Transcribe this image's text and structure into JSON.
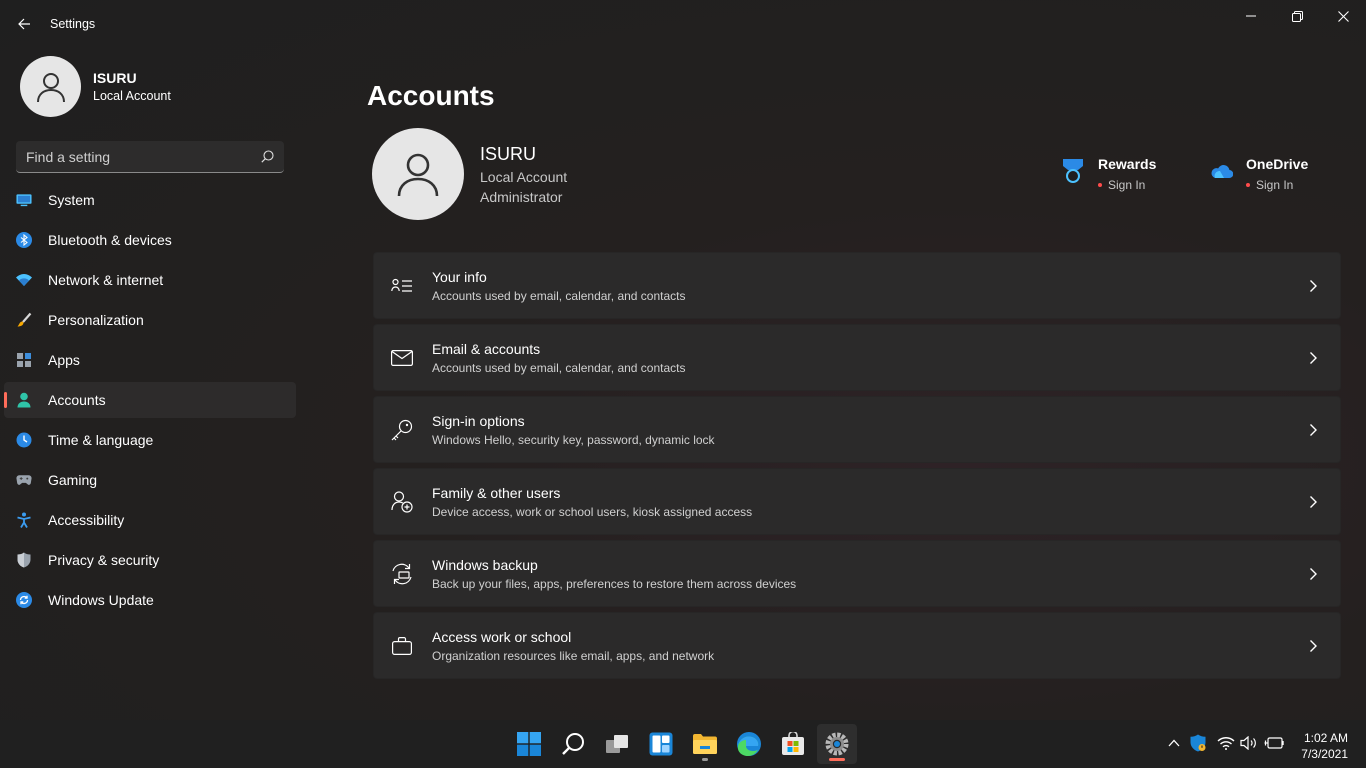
{
  "window": {
    "title": "Settings"
  },
  "sidebar": {
    "profile": {
      "name": "ISURU",
      "type": "Local Account"
    },
    "search": {
      "placeholder": "Find a setting"
    },
    "items": [
      {
        "label": "System",
        "icon": "monitor-icon",
        "selected": false
      },
      {
        "label": "Bluetooth & devices",
        "icon": "bluetooth-icon",
        "selected": false
      },
      {
        "label": "Network & internet",
        "icon": "wifi-icon",
        "selected": false
      },
      {
        "label": "Personalization",
        "icon": "paintbrush-icon",
        "selected": false
      },
      {
        "label": "Apps",
        "icon": "apps-icon",
        "selected": false
      },
      {
        "label": "Accounts",
        "icon": "person-icon",
        "selected": true
      },
      {
        "label": "Time & language",
        "icon": "clock-globe-icon",
        "selected": false
      },
      {
        "label": "Gaming",
        "icon": "gamepad-icon",
        "selected": false
      },
      {
        "label": "Accessibility",
        "icon": "accessibility-icon",
        "selected": false
      },
      {
        "label": "Privacy & security",
        "icon": "shield-icon",
        "selected": false
      },
      {
        "label": "Windows Update",
        "icon": "update-icon",
        "selected": false
      }
    ]
  },
  "main": {
    "title": "Accounts",
    "account": {
      "name": "ISURU",
      "type": "Local Account",
      "role": "Administrator"
    },
    "services": [
      {
        "title": "Rewards",
        "status": "Sign In",
        "icon": "rewards-icon"
      },
      {
        "title": "OneDrive",
        "status": "Sign In",
        "icon": "onedrive-icon"
      }
    ],
    "cards": [
      {
        "title": "Your info",
        "subtitle": "Accounts used by email, calendar, and contacts",
        "icon": "contact-card-icon"
      },
      {
        "title": "Email & accounts",
        "subtitle": "Accounts used by email, calendar, and contacts",
        "icon": "mail-icon"
      },
      {
        "title": "Sign-in options",
        "subtitle": "Windows Hello, security key, password, dynamic lock",
        "icon": "key-icon"
      },
      {
        "title": "Family & other users",
        "subtitle": "Device access, work or school users, kiosk assigned access",
        "icon": "add-person-icon"
      },
      {
        "title": "Windows backup",
        "subtitle": "Back up your files, apps, preferences to restore them across devices",
        "icon": "backup-icon"
      },
      {
        "title": "Access work or school",
        "subtitle": "Organization resources like email, apps, and network",
        "icon": "briefcase-icon"
      }
    ]
  },
  "taskbar": {
    "apps": [
      "start-icon",
      "search-icon",
      "task-view-icon",
      "widgets-icon",
      "file-explorer-icon",
      "edge-icon",
      "store-icon",
      "settings-icon"
    ],
    "clock": {
      "time": "1:02 AM",
      "date": "7/3/2021"
    }
  },
  "colors": {
    "accent": "#ff6d5a",
    "status_dot": "#ff4b4b",
    "background": "#202020"
  }
}
